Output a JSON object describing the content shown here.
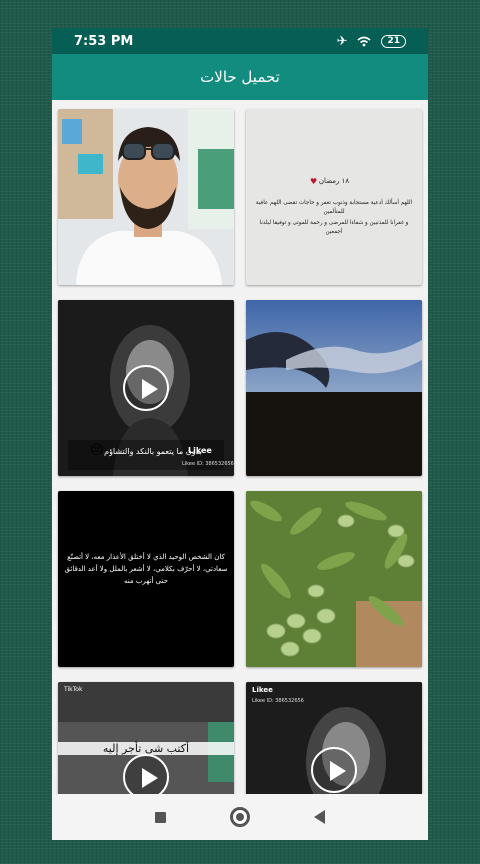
{
  "status": {
    "time": "7:53 PM",
    "battery": "21"
  },
  "appbar": {
    "title": "تحميل حالات"
  },
  "tiles": [
    {
      "kind": "image",
      "desc_icon": "portrait-photo"
    },
    {
      "kind": "text-image",
      "date": "١٨ رمضان",
      "line1": "اللهم أسألك أدعية مستجابة وذنوب تغفر و حاجات تقضى اللهم عافية للمتألمين",
      "line2": "و غفرانا للمذنبين و شفاءا للمرضى و رحمة للموتى و توفيقا لبلدنا أجمعين"
    },
    {
      "kind": "video",
      "caption": "بدون ما يتعمو بالنكد والتشاؤم",
      "logo": "Likee",
      "likee_id": "Likee ID: 386532656"
    },
    {
      "kind": "image",
      "desc_icon": "sunset-landscape"
    },
    {
      "kind": "text-image",
      "quote": "كان الشخص الوحيد الذي لا أختلق الأعذار معه، لا أتصنّع سعادتي، لا أحرّف بكلامي، لا أشعر بالملل ولا أعد الدقائق حتى أتهرب منه"
    },
    {
      "kind": "image",
      "desc_icon": "almond-tree"
    },
    {
      "kind": "video",
      "logo": "TikTok",
      "caption": "أكتب شي تأجر إليه"
    },
    {
      "kind": "video",
      "logo": "Likee",
      "likee_id": "Likee ID: 386532656"
    }
  ],
  "navbar": {
    "recents_icon": "square-icon",
    "home_icon": "circle-icon",
    "back_icon": "triangle-back-icon"
  }
}
